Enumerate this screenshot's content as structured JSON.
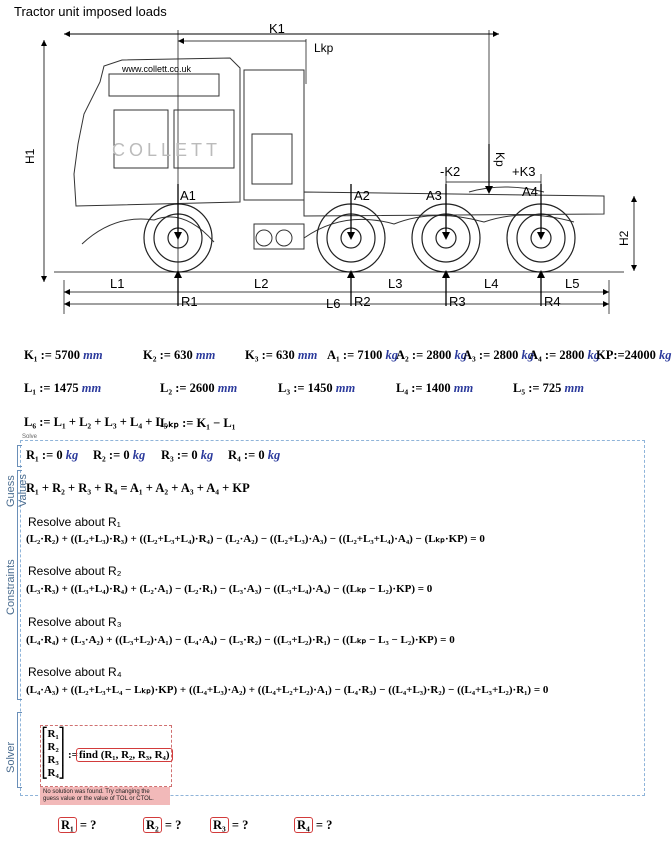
{
  "title": "Tractor unit imposed loads",
  "figure": {
    "website": "www.collett.co.uk",
    "watermark": "COLLETT",
    "labels": {
      "K1": "K1",
      "Lkp": "Lkp",
      "Kp": "Kp",
      "H1": "H1",
      "H2": "H2",
      "K2": "-K2",
      "K3": "+K3",
      "A1": "A1",
      "A2": "A2",
      "A3": "A3",
      "A4": "A4",
      "L1": "L1",
      "L2": "L2",
      "L3": "L3",
      "L4": "L4",
      "L5": "L5",
      "L6": "L6",
      "R1": "R1",
      "R2": "R2",
      "R3": "R3",
      "R4": "R4"
    }
  },
  "defs_row1": [
    {
      "name": "K₁",
      "op": ":=",
      "value": "5700",
      "unit": "mm"
    },
    {
      "name": "K₂",
      "op": ":=",
      "value": "630",
      "unit": "mm"
    },
    {
      "name": "K₃",
      "op": ":=",
      "value": "630",
      "unit": "mm"
    },
    {
      "name": "A₁",
      "op": ":=",
      "value": "7100",
      "unit": "kg"
    },
    {
      "name": "A₂",
      "op": ":=",
      "value": "2800",
      "unit": "kg"
    },
    {
      "name": "A₃",
      "op": ":=",
      "value": "2800",
      "unit": "kg"
    },
    {
      "name": "A₄",
      "op": ":=",
      "value": "2800",
      "unit": "kg"
    },
    {
      "name": "KP",
      "op": ":=",
      "value": "24000",
      "unit": "kg"
    }
  ],
  "defs_row2": [
    {
      "name": "L₁",
      "op": ":=",
      "value": "1475",
      "unit": "mm"
    },
    {
      "name": "L₂",
      "op": ":=",
      "value": "2600",
      "unit": "mm"
    },
    {
      "name": "L₃",
      "op": ":=",
      "value": "1450",
      "unit": "mm"
    },
    {
      "name": "L₄",
      "op": ":=",
      "value": "1400",
      "unit": "mm"
    },
    {
      "name": "L₅",
      "op": ":=",
      "value": "725",
      "unit": "mm"
    }
  ],
  "defs_row3": {
    "l6": "L₆ := L₁ + L₂ + L₃ + L₄ + L₅",
    "lkp": "Lₖₚ := K₁ − L₁"
  },
  "solve_block": {
    "label": "Solve",
    "guess_label": "Guess Values",
    "constraints_label": "Constraints",
    "solver_label": "Solver",
    "guesses": [
      {
        "name": "R₁",
        "op": ":=",
        "value": "0",
        "unit": "kg"
      },
      {
        "name": "R₂",
        "op": ":=",
        "value": "0",
        "unit": "kg"
      },
      {
        "name": "R₃",
        "op": ":=",
        "value": "0",
        "unit": "kg"
      },
      {
        "name": "R₄",
        "op": ":=",
        "value": "0",
        "unit": "kg"
      }
    ],
    "sum_eq": "R₁ + R₂ + R₃ + R₄ = A₁ + A₂ + A₃ + A₄ + KP",
    "resolves": [
      {
        "heading": "Resolve about R₁",
        "eq": "(L₂·R₂) + ((L₂+L₃)·R₃) + ((L₂+L₃+L₄)·R₄) − (L₂·A₂) − ((L₂+L₃)·A₃) − ((L₂+L₃+L₄)·A₄) − (Lₖₚ·KP) = 0"
      },
      {
        "heading": "Resolve about R₂",
        "eq": "(L₃·R₃) + ((L₃+L₄)·R₄) + (L₂·A₁) − (L₂·R₁) − (L₃·A₃) − ((L₃+L₄)·A₄) − ((Lₖₚ − L₂)·KP) = 0"
      },
      {
        "heading": "Resolve about R₃",
        "eq": "(L₄·R₄) + (L₃·A₂) + ((L₃+L₂)·A₁) − (L₄·A₄) − (L₃·R₂) − ((L₃+L₂)·R₁) − ((Lₖₚ − L₃ − L₂)·KP) = 0"
      },
      {
        "heading": "Resolve about R₄",
        "eq": "(L₄·A₃) + ((L₂+L₃+L₄ − Lₖₚ)·KP) + ((L₄+L₃)·A₂) + ((L₄+L₂+L₂)·A₁) − (L₄·R₃) − ((L₄+L₃)·R₂) − ((L₄+L₃+L₂)·R₁) = 0"
      }
    ],
    "solver_vector": [
      "R₁",
      "R₂",
      "R₃",
      "R₄"
    ],
    "find_call": "find (R₁, R₂, R₃, R₄)",
    "error": "No solution was found. Try changing the guess value or the value of TOL or CTOL."
  },
  "results": [
    {
      "name": "R₁",
      "op": "=",
      "value": "?"
    },
    {
      "name": "R₂",
      "op": "=",
      "value": "?"
    },
    {
      "name": "R₃",
      "op": "=",
      "value": "?"
    },
    {
      "name": "R₄",
      "op": "=",
      "value": "?"
    }
  ]
}
